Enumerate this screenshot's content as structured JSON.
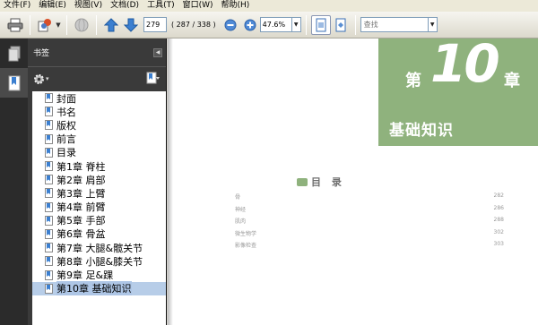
{
  "menubar": {
    "items": [
      "文件(F)",
      "编辑(E)",
      "视图(V)",
      "文档(D)",
      "工具(T)",
      "窗口(W)",
      "帮助(H)"
    ]
  },
  "toolbar": {
    "page_number": "279",
    "page_count": "( 287 / 338 )",
    "zoom": "47.6%",
    "search_placeholder": "查找"
  },
  "bookmarks": {
    "title": "书签",
    "items": [
      "封面",
      "书名",
      "版权",
      "前言",
      "目录",
      "第1章  脊柱",
      "第2章  肩部",
      "第3章  上臂",
      "第4章  前臂",
      "第5章  手部",
      "第6章  骨盆",
      "第7章  大腿&髋关节",
      "第8章  小腿&膝关节",
      "第9章  足&踝",
      "第10章  基础知识"
    ],
    "selected_index": 14
  },
  "document": {
    "chapter_prefix": "第",
    "chapter_number": "10",
    "chapter_suffix": "章",
    "chapter_title": "基础知识",
    "toc_title": "目 录",
    "toc": [
      {
        "label": "骨",
        "page": "282"
      },
      {
        "label": "神经",
        "page": "286"
      },
      {
        "label": "肌肉",
        "page": "288"
      },
      {
        "label": "微生物学",
        "page": "302"
      },
      {
        "label": "影像检查",
        "page": "303"
      }
    ]
  },
  "colors": {
    "chapter_green": "#8fb27d",
    "panel_dark": "#3a3a3a",
    "selection": "#b7cde8"
  }
}
